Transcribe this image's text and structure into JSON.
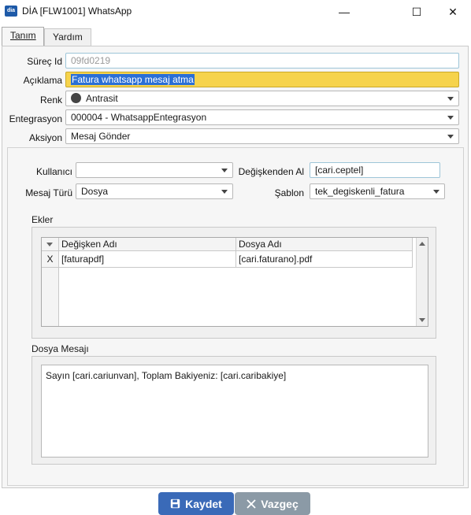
{
  "window": {
    "logo_text": "dia",
    "title": "DİA [FLW1001] WhatsApp",
    "controls": {
      "minimize": "—",
      "maximize": "☐",
      "close": "✕"
    }
  },
  "tabs": [
    {
      "label": "Tanım",
      "active": true
    },
    {
      "label": "Yardım",
      "active": false
    }
  ],
  "form": {
    "surec_id": {
      "label": "Süreç Id",
      "value": "09fd0219"
    },
    "aciklama": {
      "label": "Açıklama",
      "value": "Fatura whatsapp mesaj atma"
    },
    "renk": {
      "label": "Renk",
      "value": "Antrasit",
      "swatch_color": "#444444"
    },
    "entegrasyon": {
      "label": "Entegrasyon",
      "value": "000004 - WhatsappEntegrasyon"
    },
    "aksiyon": {
      "label": "Aksiyon",
      "value": "Mesaj Gönder"
    }
  },
  "action_panel": {
    "kullanici": {
      "label": "Kullanıcı",
      "value": ""
    },
    "degiskenden_al": {
      "label": "Değişkenden Al",
      "value": "[cari.ceptel]"
    },
    "mesaj_turu": {
      "label": "Mesaj Türü",
      "value": "Dosya"
    },
    "sablon": {
      "label": "Şablon",
      "value": "tek_degiskenli_fatura"
    }
  },
  "ekler": {
    "title": "Ekler",
    "columns": [
      "Değişken Adı",
      "Dosya Adı"
    ],
    "rows": [
      {
        "action": "X",
        "degisken_adi": "[faturapdf]",
        "dosya_adi": "[cari.faturano].pdf"
      }
    ]
  },
  "dosya_mesaji": {
    "title": "Dosya Mesajı",
    "value": "Sayın [cari.cariunvan], Toplam Bakiyeniz: [cari.caribakiye]"
  },
  "buttons": {
    "save": {
      "label": "Kaydet",
      "icon": "save-icon",
      "color": "#3a6ab8"
    },
    "cancel": {
      "label": "Vazgeç",
      "icon": "close-icon",
      "color": "#8b9aa6"
    }
  }
}
